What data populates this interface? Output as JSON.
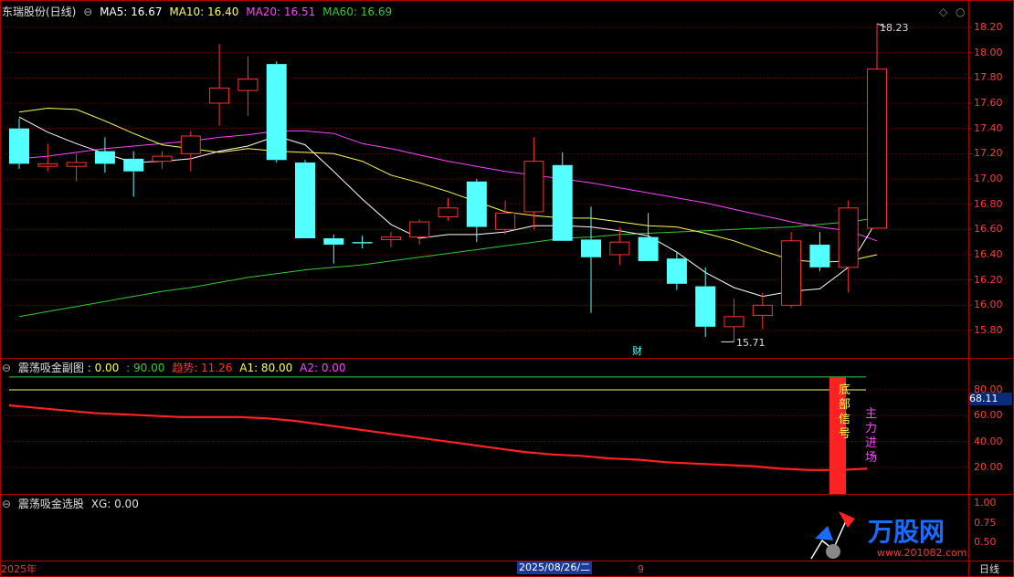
{
  "header": {
    "title": "东瑞股份(日线)",
    "ma5": "MA5: 16.67",
    "ma10": "MA10: 16.40",
    "ma20": "MA20: 16.51",
    "ma60": "MA60: 16.69"
  },
  "main_panel": {
    "y_ticks": [
      "18.20",
      "18.00",
      "17.80",
      "17.60",
      "17.40",
      "17.20",
      "17.00",
      "16.80",
      "16.60",
      "16.40",
      "16.20",
      "16.00",
      "15.80"
    ],
    "high_label": "18.23",
    "low_label": "15.71",
    "event_label": "财"
  },
  "sub_panel": {
    "title": "震荡吸金副图",
    "v1": ": 0.00",
    "v2": ": 90.00",
    "trend_label": "趋势: 11.26",
    "a1_label": "A1: 80.00",
    "a2_label": "A2: 0.00",
    "y_ticks": [
      "80.00",
      "60.00",
      "40.00",
      "20.00"
    ],
    "current_value": "68.11",
    "signal_text": [
      "底",
      "部",
      "信",
      "号"
    ],
    "inflow_text": [
      "主",
      "力",
      "进",
      "场"
    ]
  },
  "select_panel": {
    "title": "震荡吸金选股",
    "xg_label": "XG: 0.00"
  },
  "bottom_bar": {
    "left_date": "2025年",
    "mid_date": "2025/08/26/二",
    "mid_num": "9",
    "period": "日线",
    "logo_text": "万股网",
    "logo_sub": "www.201082.com"
  },
  "colors": {
    "up": "#ff3333",
    "down": "#54ffff",
    "ma5": "#ffffff",
    "ma10": "#ffff55",
    "ma20": "#ff44ff",
    "ma60": "#33cc33"
  },
  "chart_data": [
    {
      "type": "candlestick",
      "title": "东瑞股份(日线)",
      "ylim": [
        15.7,
        18.3
      ],
      "candles": [
        {
          "o": 17.4,
          "h": 17.48,
          "l": 17.08,
          "c": 17.12
        },
        {
          "o": 17.1,
          "h": 17.28,
          "l": 17.06,
          "c": 17.12
        },
        {
          "o": 17.1,
          "h": 17.2,
          "l": 16.98,
          "c": 17.13
        },
        {
          "o": 17.22,
          "h": 17.33,
          "l": 17.05,
          "c": 17.12
        },
        {
          "o": 17.16,
          "h": 17.22,
          "l": 16.86,
          "c": 17.06
        },
        {
          "o": 17.14,
          "h": 17.22,
          "l": 17.08,
          "c": 17.18
        },
        {
          "o": 17.2,
          "h": 17.38,
          "l": 17.06,
          "c": 17.34
        },
        {
          "o": 17.6,
          "h": 18.07,
          "l": 17.42,
          "c": 17.72
        },
        {
          "o": 17.7,
          "h": 17.97,
          "l": 17.5,
          "c": 17.79
        },
        {
          "o": 17.91,
          "h": 17.93,
          "l": 17.13,
          "c": 17.15
        },
        {
          "o": 17.13,
          "h": 17.15,
          "l": 16.53,
          "c": 16.53
        },
        {
          "o": 16.53,
          "h": 16.56,
          "l": 16.33,
          "c": 16.48
        },
        {
          "o": 16.5,
          "h": 16.55,
          "l": 16.45,
          "c": 16.49
        },
        {
          "o": 16.52,
          "h": 16.58,
          "l": 16.46,
          "c": 16.54
        },
        {
          "o": 16.54,
          "h": 16.68,
          "l": 16.48,
          "c": 16.66
        },
        {
          "o": 16.7,
          "h": 16.85,
          "l": 16.67,
          "c": 16.77
        },
        {
          "o": 16.98,
          "h": 17.0,
          "l": 16.5,
          "c": 16.62
        },
        {
          "o": 16.6,
          "h": 16.83,
          "l": 16.56,
          "c": 16.73
        },
        {
          "o": 16.74,
          "h": 17.33,
          "l": 16.6,
          "c": 17.14
        },
        {
          "o": 17.11,
          "h": 17.21,
          "l": 16.51,
          "c": 16.51
        },
        {
          "o": 16.52,
          "h": 16.78,
          "l": 15.94,
          "c": 16.38
        },
        {
          "o": 16.4,
          "h": 16.62,
          "l": 16.32,
          "c": 16.5
        },
        {
          "o": 16.54,
          "h": 16.73,
          "l": 16.35,
          "c": 16.35
        },
        {
          "o": 16.37,
          "h": 16.42,
          "l": 16.12,
          "c": 16.17
        },
        {
          "o": 16.15,
          "h": 16.3,
          "l": 15.75,
          "c": 15.83
        },
        {
          "o": 15.83,
          "h": 16.05,
          "l": 15.71,
          "c": 15.91
        },
        {
          "o": 15.92,
          "h": 16.1,
          "l": 15.81,
          "c": 16.0
        },
        {
          "o": 16.0,
          "h": 16.58,
          "l": 15.98,
          "c": 16.51
        },
        {
          "o": 16.48,
          "h": 16.58,
          "l": 16.27,
          "c": 16.3
        },
        {
          "o": 16.3,
          "h": 16.83,
          "l": 16.1,
          "c": 16.77
        },
        {
          "o": 16.61,
          "h": 18.23,
          "l": 16.61,
          "c": 17.87
        }
      ],
      "ma5": [
        17.49,
        17.37,
        17.28,
        17.2,
        17.13,
        17.14,
        17.16,
        17.22,
        17.26,
        17.34,
        17.27,
        17.06,
        16.84,
        16.64,
        16.53,
        16.56,
        16.56,
        16.58,
        16.63,
        16.63,
        16.62,
        16.59,
        16.55,
        16.42,
        16.26,
        16.14,
        16.07,
        16.11,
        16.13,
        16.3,
        16.67
      ],
      "ma10": [
        17.53,
        17.56,
        17.55,
        17.46,
        17.36,
        17.27,
        17.24,
        17.21,
        17.24,
        17.22,
        17.21,
        17.2,
        17.14,
        17.03,
        16.97,
        16.9,
        16.82,
        16.74,
        16.71,
        16.69,
        16.69,
        16.66,
        16.63,
        16.62,
        16.57,
        16.51,
        16.43,
        16.36,
        16.34,
        16.35,
        16.4
      ],
      "ma20": [
        17.16,
        17.18,
        17.21,
        17.24,
        17.26,
        17.28,
        17.3,
        17.33,
        17.35,
        17.38,
        17.38,
        17.36,
        17.28,
        17.24,
        17.19,
        17.14,
        17.1,
        17.06,
        17.03,
        17.0,
        16.97,
        16.93,
        16.89,
        16.85,
        16.81,
        16.76,
        16.71,
        16.66,
        16.62,
        16.59,
        16.51
      ],
      "ma60": [
        15.91,
        15.95,
        15.99,
        16.03,
        16.07,
        16.11,
        16.14,
        16.18,
        16.22,
        16.25,
        16.28,
        16.3,
        16.32,
        16.35,
        16.38,
        16.41,
        16.44,
        16.47,
        16.5,
        16.53,
        16.54,
        16.56,
        16.57,
        16.58,
        16.59,
        16.6,
        16.61,
        16.62,
        16.64,
        16.66,
        16.69
      ]
    },
    {
      "type": "line",
      "title": "震荡吸金副图",
      "ylim": [
        0,
        100
      ],
      "series": [
        {
          "name": "趋势",
          "values": [
            68,
            66,
            64,
            62,
            61,
            60,
            59,
            59,
            59,
            58,
            56,
            53,
            50,
            47,
            44,
            41,
            38,
            35,
            32,
            30,
            29,
            27,
            26,
            24,
            23,
            22,
            21,
            19,
            18,
            18,
            19
          ]
        },
        {
          "name": "A1",
          "values": [
            80
          ]
        },
        {
          "name": "A2",
          "values": [
            0
          ]
        }
      ]
    }
  ]
}
